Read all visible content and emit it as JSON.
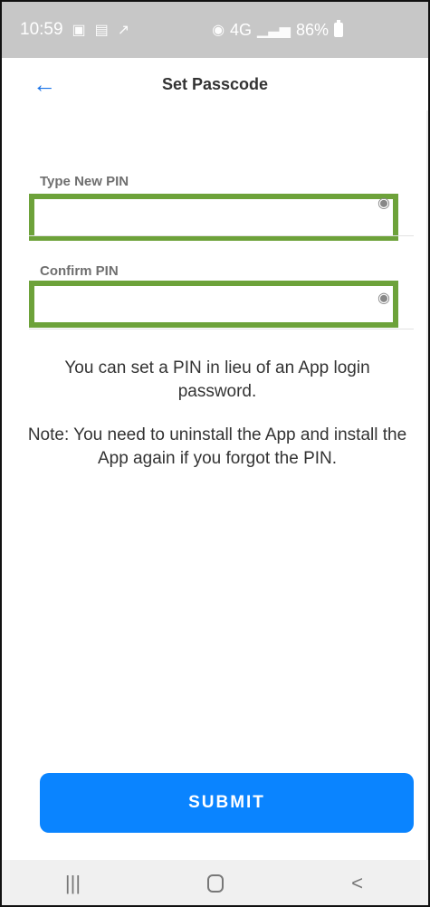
{
  "status": {
    "time": "10:59",
    "left_icons": [
      "image-icon",
      "app-icon",
      "share-icon"
    ],
    "network": "4G",
    "battery_text": "86%"
  },
  "header": {
    "title": "Set Passcode",
    "back_icon": "back-arrow-icon"
  },
  "form": {
    "new_pin_label": "Type New PIN",
    "confirm_pin_label": "Confirm PIN",
    "new_pin_value": "",
    "confirm_pin_value": "",
    "eye_icon": "visibility-icon"
  },
  "notes": {
    "line1": "You can set a PIN in lieu of an App login password.",
    "line2": "Note: You need to uninstall the App and install the App again if you forgot the PIN."
  },
  "actions": {
    "submit_label": "SUBMIT"
  },
  "nav": {
    "recent": "|||",
    "home": "",
    "back": "<"
  },
  "colors": {
    "accent": "#0a84ff",
    "highlight": "#6da23a"
  }
}
